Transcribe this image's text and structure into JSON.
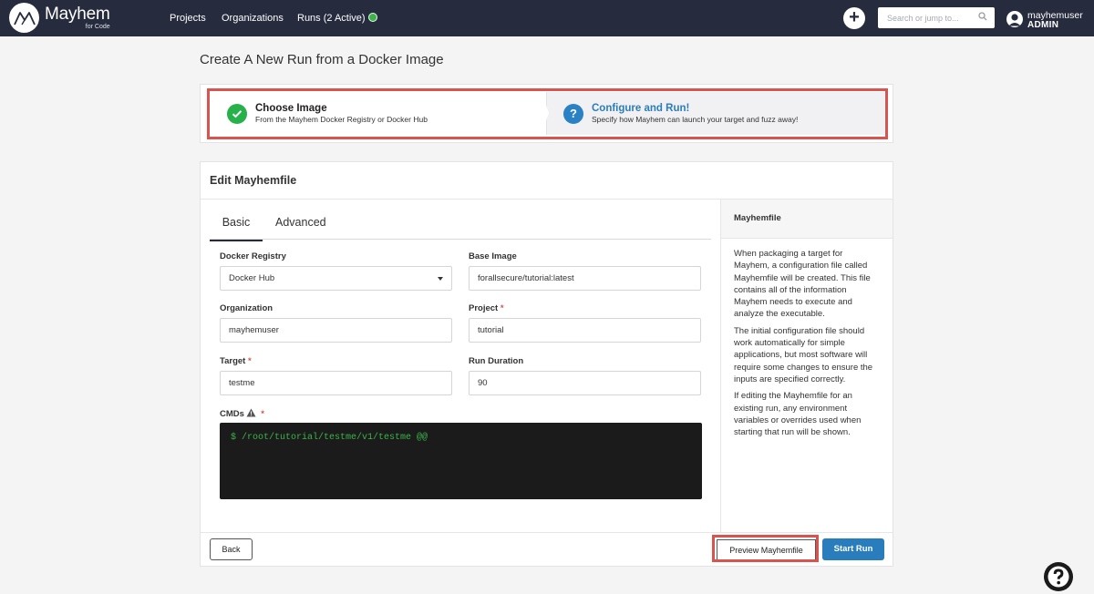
{
  "app": {
    "logo_name": "Mayhem",
    "logo_sub": "for Code"
  },
  "nav": {
    "projects": "Projects",
    "organizations": "Organizations",
    "runs": "Runs (2 Active)"
  },
  "header": {
    "search_placeholder": "Search or jump to...",
    "username": "mayhemuser",
    "role": "ADMIN"
  },
  "page": {
    "title": "Create A New Run from a Docker Image"
  },
  "stepper": {
    "steps": [
      {
        "title": "Choose Image",
        "subtitle": "From the Mayhem Docker Registry or Docker Hub",
        "status": "complete"
      },
      {
        "title": "Configure and Run!",
        "subtitle": "Specify how Mayhem can launch your target and fuzz away!",
        "status": "current"
      }
    ]
  },
  "editor": {
    "title": "Edit Mayhemfile",
    "tabs": [
      "Basic",
      "Advanced"
    ],
    "active_tab": "Basic",
    "fields": {
      "docker_registry": {
        "label": "Docker Registry",
        "value": "Docker Hub"
      },
      "base_image": {
        "label": "Base Image",
        "value": "forallsecure/tutorial:latest"
      },
      "organization": {
        "label": "Organization",
        "value": "mayhemuser"
      },
      "project": {
        "label": "Project",
        "value": "tutorial",
        "required": "*"
      },
      "target": {
        "label": "Target",
        "value": "testme",
        "required": "*"
      },
      "run_duration": {
        "label": "Run Duration",
        "value": "90"
      },
      "cmds": {
        "label": "CMDs",
        "value": "$ /root/tutorial/testme/v1/testme @@",
        "required": "*"
      }
    }
  },
  "side_panel": {
    "title": "Mayhemfile",
    "paragraphs": [
      "When packaging a target for Mayhem, a configuration file called Mayhemfile will be created. This file contains all of the information Mayhem needs to execute and analyze the executable.",
      "The initial configuration file should work automatically for simple applications, but most software will require some changes to ensure the inputs are specified correctly.",
      "If editing the Mayhemfile for an existing run, any environment variables or overrides used when starting that run will be shown."
    ]
  },
  "footer": {
    "back": "Back",
    "preview": "Preview Mayhemfile",
    "start": "Start Run"
  },
  "colors": {
    "nav_bg": "#262b3e",
    "primary": "#2a7dbd",
    "success": "#26b14a",
    "highlight": "#d9534f"
  },
  "icons": [
    "mayhem-logo-icon",
    "runs-status-icon",
    "plus-icon",
    "search-icon",
    "user-avatar-icon",
    "check-icon",
    "question-icon",
    "warning-icon",
    "dropdown-caret-icon",
    "help-icon"
  ]
}
